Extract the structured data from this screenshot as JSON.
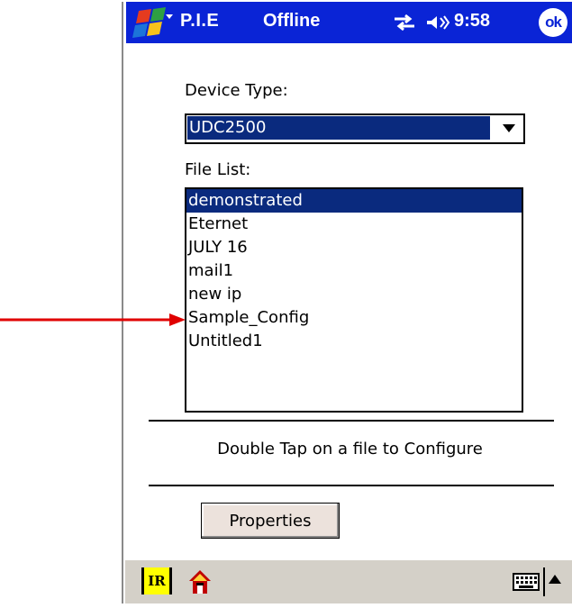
{
  "titlebar": {
    "app_title": "P.I.E",
    "status": "Offline",
    "time": "9:58",
    "ok_label": "ok",
    "color": "#0a24d6"
  },
  "form": {
    "device_type_label": "Device Type:",
    "device_type_value": "UDC2500",
    "file_list_label": "File List:",
    "files": [
      "demonstrated",
      "Eternet",
      "JULY 16",
      "mail1",
      "new ip",
      "Sample_Config",
      "Untitled1"
    ],
    "selected_file": "demonstrated",
    "hint": "Double Tap on a file to Configure",
    "properties_button": "Properties",
    "selection_color": "#0a2a7e"
  },
  "taskbar": {
    "ir_label": "IR",
    "icons": [
      "ir-icon",
      "home-icon",
      "keyboard-icon",
      "sip-arrow-icon"
    ]
  },
  "annotation": {
    "arrow_color": "#e00000",
    "points_to": "Sample_Config"
  }
}
